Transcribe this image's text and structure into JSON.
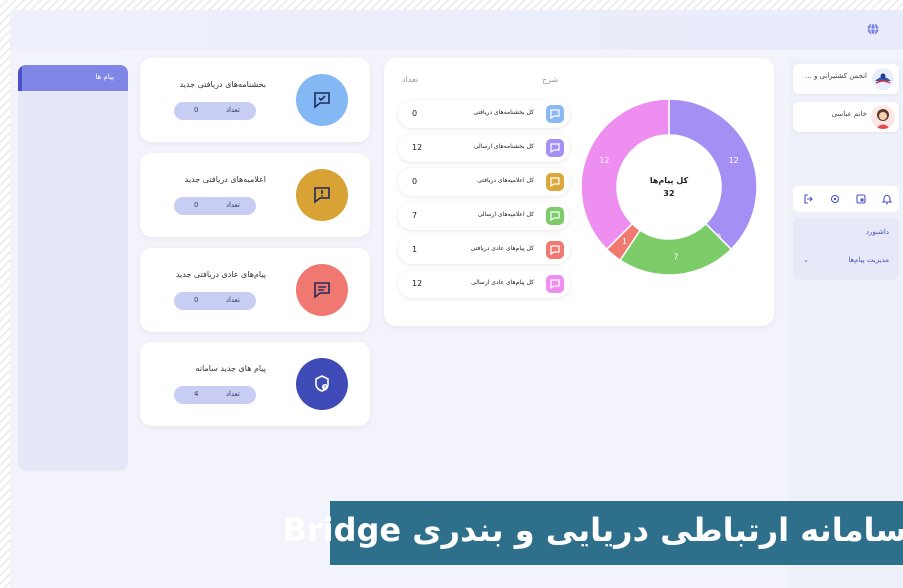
{
  "topbar": {
    "icon": "globe-icon"
  },
  "right_sidebar": {
    "org_name": "انجمن کشتیرانی و ...",
    "user_name": "خانم عباسی",
    "menu": [
      {
        "label": "داشبورد"
      },
      {
        "label": "مدیریت پیام‌ها"
      }
    ],
    "icons": [
      "logout-icon",
      "settings-icon",
      "window-icon",
      "notification-icon"
    ]
  },
  "left_sidebar": {
    "items": [
      {
        "label": "پیام ها"
      }
    ]
  },
  "stats": [
    {
      "title": "بخشنامه‌های دریافتی جدید",
      "count_label": "تعداد",
      "count": "0",
      "color": "#83b8f4",
      "icon": "message-check-icon"
    },
    {
      "title": "اعلامیه‌های دریافتی جدید",
      "count_label": "تعداد",
      "count": "0",
      "color": "#d9a234",
      "icon": "message-alert-icon"
    },
    {
      "title": "پیام‌های عادی دریافتی جدید",
      "count_label": "تعداد",
      "count": "0",
      "color": "#ef7870",
      "icon": "message-text-icon"
    },
    {
      "title": "پیام های جدید سامانه",
      "count_label": "تعداد",
      "count": "4",
      "color": "#3f4bb6",
      "icon": "shield-alert-icon"
    }
  ],
  "summary": {
    "col_desc": "شرح",
    "col_count": "تعداد",
    "rows": [
      {
        "label": "کل بخشنامه‌های دریافتی",
        "value": "0",
        "color": "#8ab8f2"
      },
      {
        "label": "کل بخشنامه‌های ارسالی",
        "value": "12",
        "color": "#a58ef4"
      },
      {
        "label": "کل اعلامیه‌های دریافتی",
        "value": "0",
        "color": "#dba83c"
      },
      {
        "label": "کل اعلامیه‌های ارسالی",
        "value": "7",
        "color": "#7ccc6a"
      },
      {
        "label": "کل پیام‌های عادی دریافتی",
        "value": "1",
        "color": "#f07a72"
      },
      {
        "label": "کل پیام‌های عادی ارسالی",
        "value": "12",
        "color": "#ee8ef0"
      }
    ]
  },
  "chart_data": {
    "type": "pie",
    "title": "کل پیام‌ها",
    "total": "32",
    "slices": [
      {
        "value": 0,
        "label": "0",
        "color": "#8ab8f2"
      },
      {
        "value": 12,
        "label": "12",
        "color": "#a58ef4"
      },
      {
        "value": 0,
        "label": "0",
        "color": "#dba83c"
      },
      {
        "value": 7,
        "label": "7",
        "color": "#7ccc6a"
      },
      {
        "value": 1,
        "label": "1",
        "color": "#f07a72"
      },
      {
        "value": 12,
        "label": "12",
        "color": "#ee8ef0"
      }
    ]
  },
  "banner": {
    "text": "سامانه ارتباطی دریایی و بندری Bridge"
  }
}
